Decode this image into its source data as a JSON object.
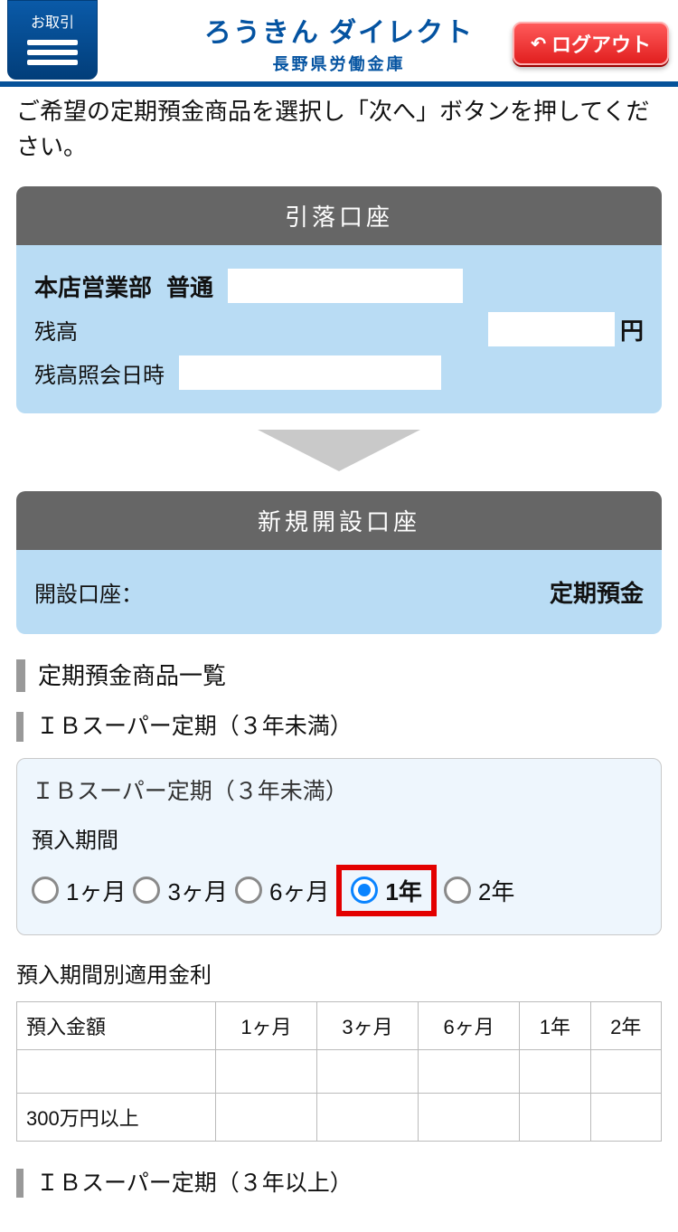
{
  "header": {
    "menu_label": "お取引",
    "brand_main": "ろうきん ダイレクト",
    "brand_sub": "長野県労働金庫",
    "logout": "ログアウト"
  },
  "intro": "ご希望の定期預金商品を選択し「次へ」ボタンを押してください。",
  "debit": {
    "title": "引落口座",
    "branch": "本店営業部",
    "type": "普通",
    "balance_label": "残高",
    "balance_unit": "円",
    "inquiry_label": "残高照会日時"
  },
  "newacc": {
    "title": "新規開設口座",
    "label": "開設口座：",
    "value": "定期預金"
  },
  "list_title": "定期預金商品一覧",
  "group1_title": "ＩＢスーパー定期（３年未満）",
  "product": {
    "name": "ＩＢスーパー定期（３年未満）",
    "period_label": "預入期間",
    "options": [
      "1ヶ月",
      "3ヶ月",
      "6ヶ月",
      "1年",
      "2年"
    ],
    "selected_index": 3
  },
  "rates": {
    "caption": "預入期間別適用金利",
    "head": [
      "預入金額",
      "1ヶ月",
      "3ヶ月",
      "6ヶ月",
      "1年",
      "2年"
    ],
    "rows": [
      [
        "",
        "",
        "",
        "",
        "",
        ""
      ],
      [
        "300万円以上",
        "",
        "",
        "",
        "",
        ""
      ]
    ]
  },
  "group2_title": "ＩＢスーパー定期（３年以上）"
}
